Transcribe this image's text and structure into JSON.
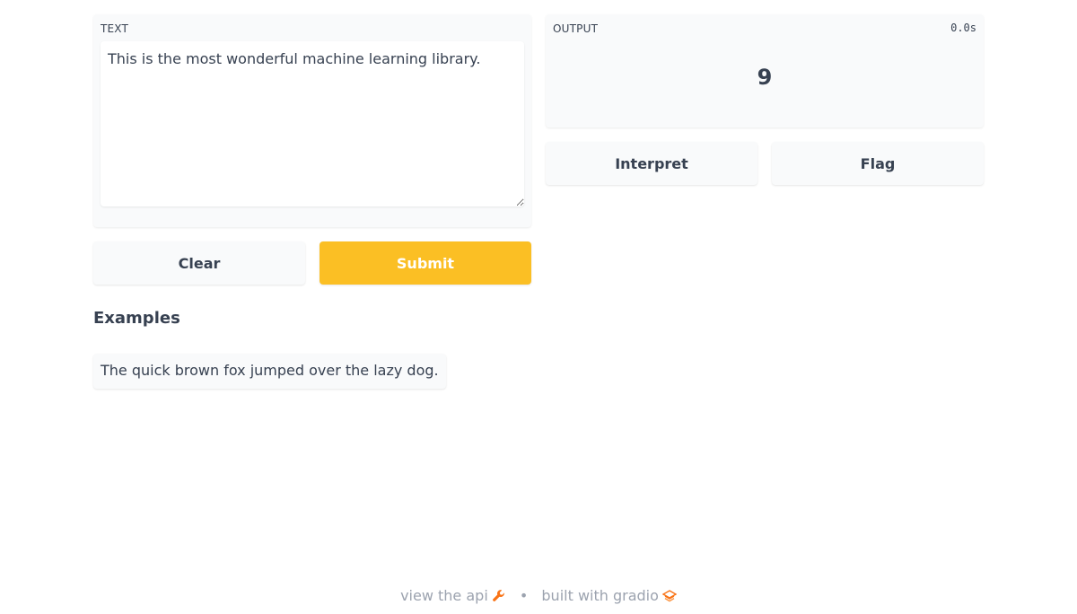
{
  "input": {
    "label": "TEXT",
    "value": "This is the most wonderful machine learning library."
  },
  "output": {
    "label": "OUTPUT",
    "timer": "0.0s",
    "value": "9"
  },
  "buttons": {
    "clear": "Clear",
    "submit": "Submit",
    "interpret": "Interpret",
    "flag": "Flag"
  },
  "examples": {
    "title": "Examples",
    "items": [
      "The quick brown fox jumped over the lazy dog."
    ]
  },
  "footer": {
    "api_link": "view the api",
    "separator": "•",
    "built_with": "built with gradio",
    "api_icon": "wrench-icon",
    "gradio_icon": "gradio-logo-icon"
  },
  "colors": {
    "accent": "#fbbf24",
    "panel_bg": "#f9fafb",
    "text": "#374151",
    "muted": "#9ca3af",
    "icon_orange": "#f97316"
  }
}
